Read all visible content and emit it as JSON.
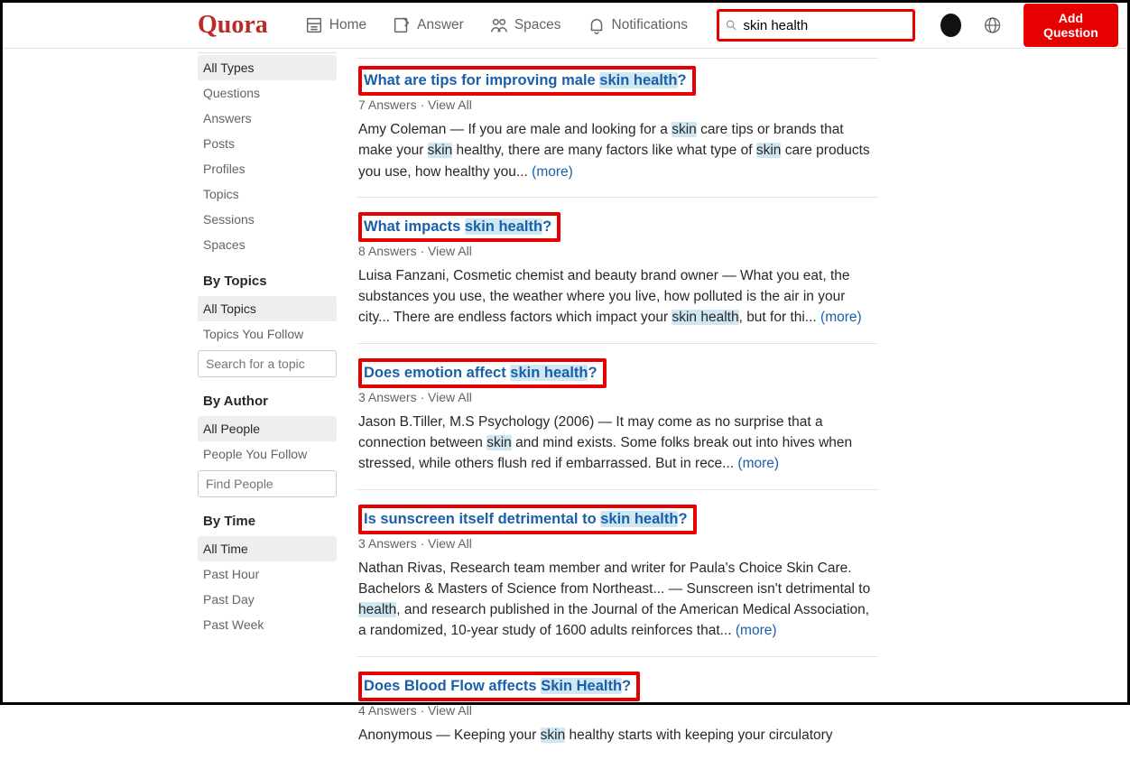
{
  "header": {
    "logo": "Quora",
    "nav": {
      "home": "Home",
      "answer": "Answer",
      "spaces": "Spaces",
      "notifications": "Notifications"
    },
    "search_value": "skin health",
    "add_question": "Add Question"
  },
  "sidebar": {
    "types": [
      "All Types",
      "Questions",
      "Answers",
      "Posts",
      "Profiles",
      "Topics",
      "Sessions",
      "Spaces"
    ],
    "by_topics_heading": "By Topics",
    "topics": [
      "All Topics",
      "Topics You Follow"
    ],
    "topic_search_placeholder": "Search for a topic",
    "by_author_heading": "By Author",
    "authors": [
      "All People",
      "People You Follow"
    ],
    "people_search_placeholder": "Find People",
    "by_time_heading": "By Time",
    "times": [
      "All Time",
      "Past Hour",
      "Past Day",
      "Past Week"
    ]
  },
  "results": [
    {
      "title_pre": "What are tips for improving male ",
      "title_hl": "skin health",
      "title_post": "?",
      "meta": "7 Answers",
      "viewall": "View All",
      "snippet_html": "Amy Coleman — If you are male and looking for a <span class='hl'>skin</span> care tips or brands that make your <span class='hl'>skin</span> healthy, there are many factors like what type of <span class='hl'>skin</span> care products you use, how healthy you... "
    },
    {
      "title_pre": "What impacts ",
      "title_hl": "skin health",
      "title_post": "?",
      "meta": "8 Answers",
      "viewall": "View All",
      "snippet_html": "Luisa Fanzani, Cosmetic chemist and beauty brand owner — What you eat, the substances you use, the weather where you live, how polluted is the air in your city... There are endless factors which impact your <span class='hl'>skin health</span>, but for thi... "
    },
    {
      "title_pre": "Does emotion affect ",
      "title_hl": "skin health",
      "title_post": "?",
      "meta": "3 Answers",
      "viewall": "View All",
      "snippet_html": "Jason B.Tiller, M.S Psychology (2006) — It may come as no surprise that a connection between <span class='hl'>skin</span> and mind exists. Some folks break out into hives when stressed, while others flush red if embarrassed. But in rece... "
    },
    {
      "title_pre": "Is sunscreen itself detrimental to ",
      "title_hl": "skin health",
      "title_post": "?",
      "meta": "3 Answers",
      "viewall": "View All",
      "snippet_html": "Nathan Rivas, Research team member and writer for Paula's Choice Skin Care. Bachelors & Masters of Science from Northeast... — Sunscreen isn't detrimental to <span class='hl'>health</span>, and research published in the Journal of the American Medical Association, a randomized, 10-year study of 1600 adults reinforces that... "
    },
    {
      "title_pre": "Does Blood Flow affects ",
      "title_hl": "Skin Health",
      "title_post": "?",
      "meta": "4 Answers",
      "viewall": "View All",
      "snippet_html": "Anonymous — Keeping your <span class='hl'>skin</span> healthy starts with keeping your circulatory "
    }
  ],
  "more_label": "(more)"
}
